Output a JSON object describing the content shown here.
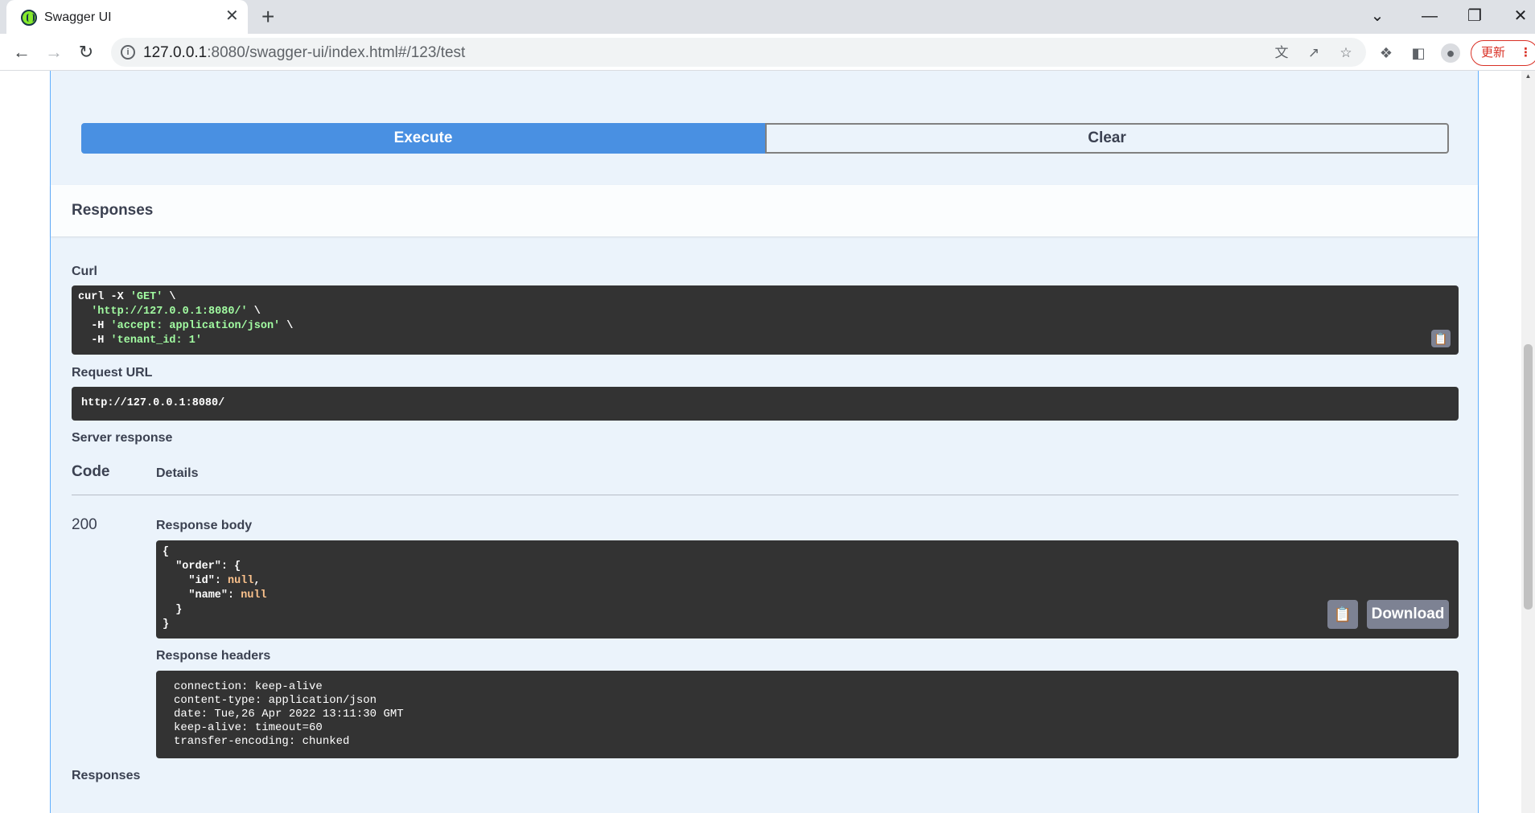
{
  "browser": {
    "tab_title": "Swagger UI",
    "tab_close": "✕",
    "new_tab": "+",
    "url_host": "127.0.0.1",
    "url_rest": ":8080/swagger-ui/index.html#/123/test",
    "update_label": "更新",
    "window_controls": [
      "⌄",
      "—",
      "❐",
      "✕"
    ]
  },
  "actions": {
    "execute_label": "Execute",
    "clear_label": "Clear"
  },
  "responses": {
    "title": "Responses",
    "curl_label": "Curl",
    "curl": {
      "line1_cmd": "curl -X ",
      "line1_str": "'GET'",
      "line1_end": " \\",
      "line2_str": "'http://127.0.0.1:8080/'",
      "line2_end": " \\",
      "line3_cmd": "-H ",
      "line3_str": "'accept: application/json'",
      "line3_end": " \\",
      "line4_cmd": "-H ",
      "line4_str": "'tenant_id: 1'"
    },
    "request_url_label": "Request URL",
    "request_url": "http://127.0.0.1:8080/",
    "server_response_label": "Server response",
    "code_header": "Code",
    "details_header": "Details",
    "status_code": "200",
    "response_body_label": "Response body",
    "body": {
      "open": "{",
      "order_key": "\"order\"",
      "order_open": ": {",
      "id_key": "\"id\"",
      "id_sep": ": ",
      "id_val": "null",
      "id_comma": ",",
      "name_key": "\"name\"",
      "name_sep": ": ",
      "name_val": "null",
      "order_close": "}",
      "close": "}"
    },
    "download_label": "Download",
    "response_headers_label": "Response headers",
    "headers": [
      "connection: keep-alive",
      "content-type: application/json",
      "date: Tue,26 Apr 2022 13:11:30 GMT",
      "keep-alive: timeout=60",
      "transfer-encoding: chunked"
    ],
    "footer_label": "Responses"
  },
  "icons": {
    "back": "back-arrow-icon",
    "forward": "forward-arrow-icon",
    "reload": "reload-icon",
    "info": "info-icon",
    "translate": "translate-icon",
    "share": "share-icon",
    "star": "star-icon",
    "extensions": "puzzle-icon",
    "sidepanel": "side-panel-icon",
    "profile": "profile-icon",
    "menu": "kebab-menu-icon",
    "copy": "clipboard-icon"
  },
  "colors": {
    "execute": "#4990e2",
    "opblock_bg": "#ebf3fb",
    "opblock_border": "#61affe",
    "code_bg": "#333333",
    "string": "#a2fca2",
    "null": "#fcc28c",
    "update": "#d93025"
  }
}
